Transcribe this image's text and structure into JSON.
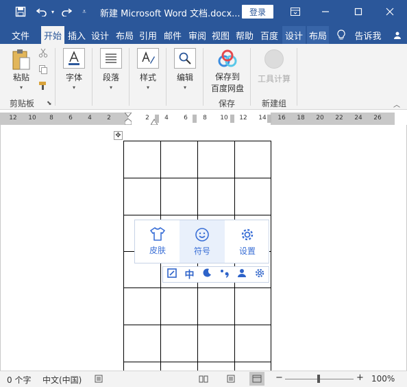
{
  "titlebar": {
    "title": "新建 Microsoft Word 文档.docx...",
    "login": "登录"
  },
  "tabs": [
    "文件",
    "开始",
    "插入",
    "设计",
    "布局",
    "引用",
    "邮件",
    "审阅",
    "视图",
    "帮助",
    "百度",
    "设计",
    "布局"
  ],
  "tell_me": "告诉我",
  "ribbon": {
    "paste": "粘贴",
    "clipboard_group": "剪贴板",
    "font": "字体",
    "paragraph": "段落",
    "styles": "样式",
    "editing": "编辑",
    "save_to_baidu_line1": "保存到",
    "save_to_baidu_line2": "百度网盘",
    "save_group": "保存",
    "tool_calc": "工具计算",
    "new_group": "新建组"
  },
  "ruler": {
    "left_numbers": [
      "12",
      "10",
      "8",
      "6",
      "4",
      "2"
    ],
    "right_numbers": [
      "2",
      "4",
      "6",
      "8",
      "10",
      "12",
      "14",
      "16",
      "18",
      "20",
      "22",
      "24",
      "26"
    ]
  },
  "ime": {
    "skin": "皮肤",
    "symbol": "符号",
    "settings": "设置",
    "toolbar_chinese": "中"
  },
  "statusbar": {
    "word_count": "0 个字",
    "language": "中文(中国)",
    "zoom": "100%",
    "minus": "−",
    "plus": "+"
  },
  "colors": {
    "accent": "#2b579a",
    "ime_blue": "#3a6fd6"
  }
}
